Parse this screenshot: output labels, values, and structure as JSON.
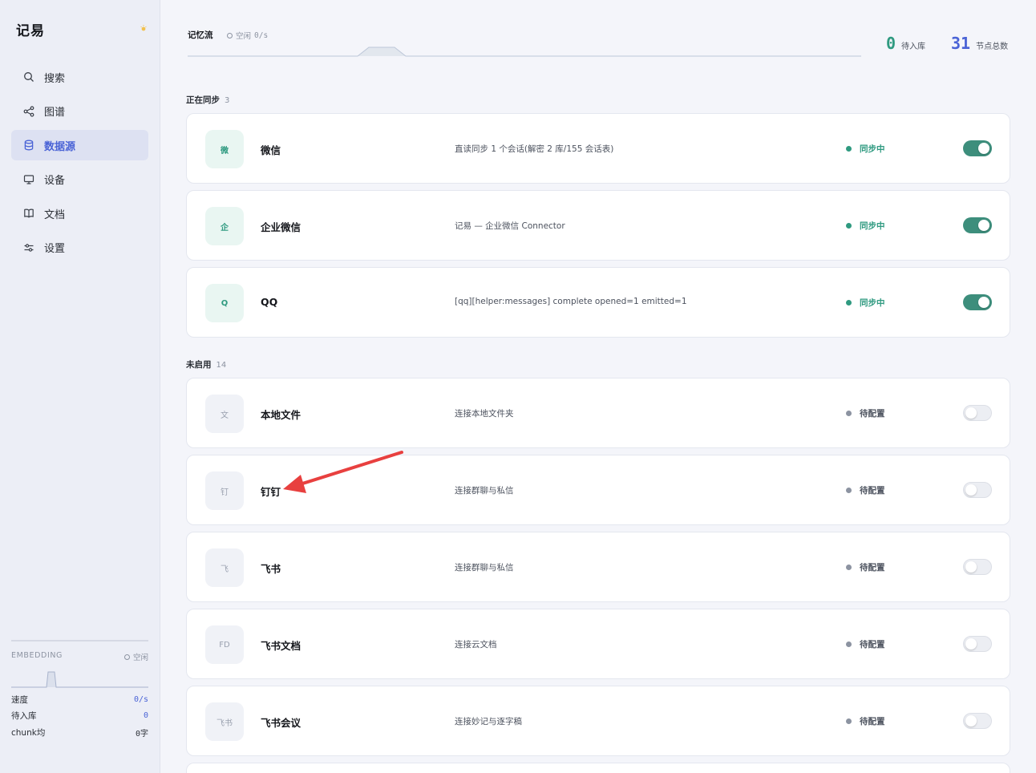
{
  "app": {
    "title": "记易"
  },
  "sidebar": {
    "items": [
      {
        "label": "搜索",
        "icon": "search-icon",
        "active": false
      },
      {
        "label": "图谱",
        "icon": "share-graph-icon",
        "active": false
      },
      {
        "label": "数据源",
        "icon": "database-icon",
        "active": true
      },
      {
        "label": "设备",
        "icon": "monitor-icon",
        "active": false
      },
      {
        "label": "文档",
        "icon": "book-icon",
        "active": false
      },
      {
        "label": "设置",
        "icon": "sliders-icon",
        "active": false
      }
    ]
  },
  "embedding": {
    "title": "EMBEDDING",
    "status": "空闲",
    "rows": [
      {
        "label": "速度",
        "value": "0/s"
      },
      {
        "label": "待入库",
        "value": "0"
      },
      {
        "label": "chunk均",
        "value": "0字"
      }
    ]
  },
  "header": {
    "flow_title": "记忆流",
    "flow_status": "空闲",
    "flow_rate": "0/s",
    "stats": [
      {
        "value": "0",
        "label": "待入库",
        "color": "#2f9a80"
      },
      {
        "value": "31",
        "label": "节点总数",
        "color": "#4a63d6"
      }
    ]
  },
  "sections": {
    "syncing": {
      "title": "正在同步",
      "count": "3"
    },
    "disabled": {
      "title": "未启用",
      "count": "14"
    }
  },
  "sources_syncing": [
    {
      "icon_text": "微",
      "name": "微信",
      "desc": "直读同步 1 个会话(解密 2 库/155 会话表)",
      "status": "同步中"
    },
    {
      "icon_text": "企",
      "name": "企业微信",
      "desc": "记易 — 企业微信 Connector",
      "status": "同步中"
    },
    {
      "icon_text": "Q",
      "name": "QQ",
      "desc": "[qq][helper:messages] complete opened=1 emitted=1",
      "status": "同步中"
    }
  ],
  "sources_disabled": [
    {
      "icon_text": "文",
      "name": "本地文件",
      "desc": "连接本地文件夹",
      "status": "待配置"
    },
    {
      "icon_text": "钉",
      "name": "钉钉",
      "desc": "连接群聊与私信",
      "status": "待配置"
    },
    {
      "icon_text": "飞",
      "name": "飞书",
      "desc": "连接群聊与私信",
      "status": "待配置"
    },
    {
      "icon_text": "FD",
      "name": "飞书文档",
      "desc": "连接云文档",
      "status": "待配置"
    },
    {
      "icon_text": "飞书",
      "name": "飞书会议",
      "desc": "连接妙记与逐字稿",
      "status": "待配置"
    }
  ],
  "colors": {
    "accent": "#4a63d6",
    "sync_green": "#2f9a80",
    "toggle_on": "#3d8e7c",
    "pending_gray": "#8c93a1",
    "annotation_arrow": "#e8403f"
  }
}
